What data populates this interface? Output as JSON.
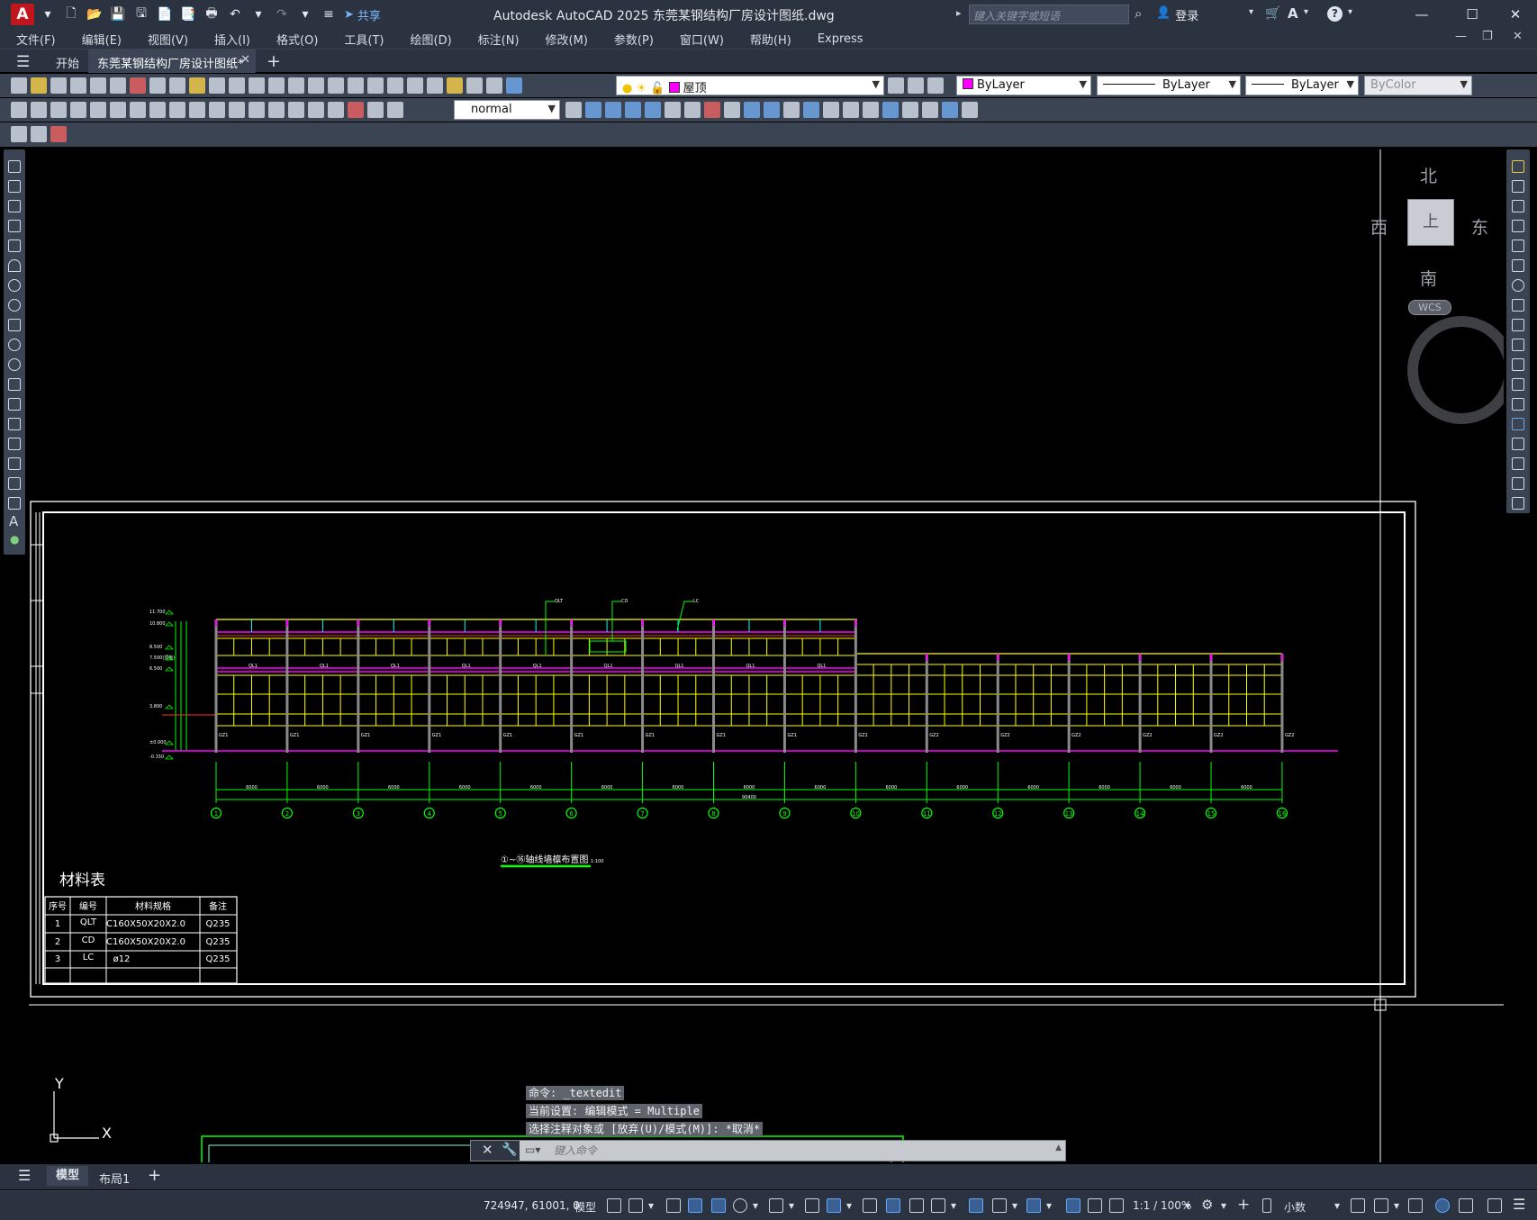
{
  "app": {
    "logo": "A",
    "title": "Autodesk AutoCAD 2025    东莞某钢结构厂房设计图纸.dwg",
    "share_label": "共享",
    "search_placeholder": "键入关键字或短语",
    "signin_label": "登录"
  },
  "menu": [
    "文件(F)",
    "编辑(E)",
    "视图(V)",
    "插入(I)",
    "格式(O)",
    "工具(T)",
    "绘图(D)",
    "标注(N)",
    "修改(M)",
    "参数(P)",
    "窗口(W)",
    "帮助(H)",
    "Express"
  ],
  "tabs": {
    "start": "开始",
    "document": "东莞某钢结构厂房设计图纸*"
  },
  "properties": {
    "layer": "屋顶",
    "color": "ByLayer",
    "linetype": "ByLayer",
    "lineweight": "ByLayer",
    "plotstyle": "ByColor",
    "textstyle": "normal",
    "layer_color": "#ff00ff"
  },
  "viewcube": {
    "north": "北",
    "south": "南",
    "east": "东",
    "west": "西",
    "face": "上",
    "wcs": "WCS"
  },
  "drawing": {
    "elevations": [
      "11.700",
      "10.800",
      "8.500",
      "7.500(顶板)",
      "6.500",
      "3.800",
      "±0.000",
      "-0.150"
    ],
    "purlin_tags": [
      "QLT",
      "CD",
      "LC"
    ],
    "grid_labels": [
      "1",
      "2",
      "3",
      "4",
      "5",
      "6",
      "7",
      "8",
      "9",
      "10",
      "11",
      "12",
      "13",
      "14",
      "15",
      "16"
    ],
    "dims": [
      "6000",
      "6000",
      "6000",
      "6000",
      "6000",
      "6000",
      "6000",
      "6000",
      "6000",
      "6000",
      "6000",
      "6000",
      "6000",
      "6000",
      "6000"
    ],
    "total_dim": "90400",
    "view_title": "①~⑯轴线墙檩布置图",
    "view_scale": "1:100",
    "column_tags": [
      "GZ1",
      "GZ2",
      "GZ2"
    ],
    "purlin_label": "QL1",
    "material_table": {
      "title": "材料表",
      "headers": [
        "序号",
        "编号",
        "材料规格",
        "备注"
      ],
      "rows": [
        [
          "1",
          "QLT",
          "C160X50X20X2.0",
          "Q235"
        ],
        [
          "2",
          "CD",
          "C160X50X20X2.0",
          "Q235"
        ],
        [
          "3",
          "LC",
          "ø12",
          "Q235"
        ]
      ]
    },
    "ucs_x": "X",
    "ucs_y": "Y"
  },
  "command": {
    "history": [
      "命令: _textedit",
      "当前设置: 编辑模式 = Multiple",
      "选择注释对象或 [放弃(U)/模式(M)]: *取消*"
    ],
    "placeholder": "键入命令"
  },
  "layout_tabs": [
    "模型",
    "布局1"
  ],
  "status": {
    "coords": "724947, 61001, 0",
    "model_label": "模型",
    "annotation_scale": "1:1 / 100%",
    "units": "小数"
  },
  "colors": {
    "chrome": "#2b3340",
    "toolbar": "#3b4453",
    "green": "#00ff00",
    "magenta": "#ff00ff",
    "yellow": "#ffff00",
    "cyan": "#00ffff"
  }
}
